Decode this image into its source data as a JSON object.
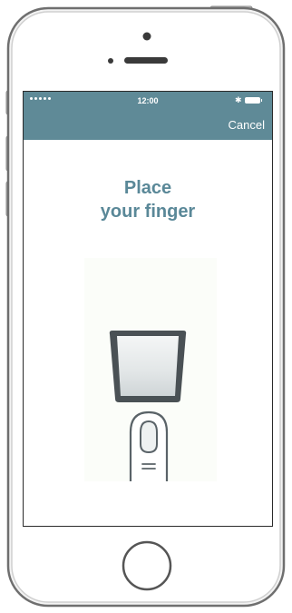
{
  "status_bar": {
    "time": "12:00",
    "signal_icon": "signal-dots-icon",
    "bluetooth_icon": "bluetooth-icon",
    "battery_icon": "battery-icon"
  },
  "nav_bar": {
    "cancel_label": "Cancel"
  },
  "main": {
    "title_line1": "Place",
    "title_line2": "your finger",
    "illustration_icon": "finger-on-sensor-icon"
  },
  "colors": {
    "accent": "#5f8a97",
    "title": "#5a8898"
  }
}
